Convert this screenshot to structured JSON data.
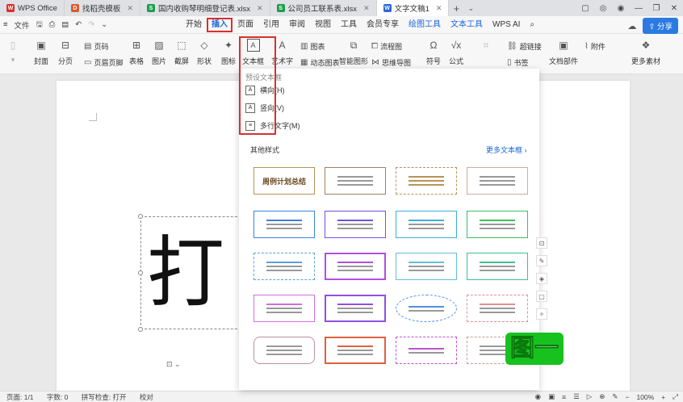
{
  "tabs": [
    {
      "label": "WPS Office",
      "icon": "wps-logo-icon",
      "color": "#d9302c"
    },
    {
      "label": "找稻壳模板",
      "icon": "docer-icon",
      "color": "#e0572a"
    },
    {
      "label": "国内收购琴明细登记表.xlsx",
      "icon": "sheet-icon",
      "color": "#1e9e4a"
    },
    {
      "label": "公司员工联系表.xlsx",
      "icon": "sheet-icon",
      "color": "#1e9e4a"
    },
    {
      "label": "文字文稿1",
      "icon": "writer-icon",
      "color": "#2a66d6"
    }
  ],
  "menu": {
    "file_label": "文件",
    "items": [
      "开始",
      "插入",
      "页面",
      "引用",
      "审阅",
      "视图",
      "工具",
      "会员专享",
      "绘图工具",
      "文本工具",
      "WPS AI"
    ],
    "active": "插入",
    "share_label": "分享"
  },
  "ribbon": {
    "cover": "封面",
    "page_break": "分页",
    "page_code": "页码",
    "header_footer": "页眉页脚",
    "table": "表格",
    "picture": "图片",
    "screenshot": "截屏",
    "shape": "形状",
    "icon": "图标",
    "textbox": "文本框",
    "art_text": "艺术字",
    "chart": "图表",
    "dynamic_chart": "动态图表",
    "smart_graphic": "智能图形",
    "flowchart": "流程图",
    "mindmap": "思维导图",
    "symbol": "符号",
    "formula": "公式",
    "hyperlink": "超链接",
    "bookmark": "书签",
    "doc_parts": "文档部件",
    "attachment": "附件",
    "more_material": "更多素材"
  },
  "dropdown": {
    "preset_section": "预设文本框",
    "horizontal": "横向(H)",
    "vertical": "竖向(V)",
    "multiline": "多行文字(M)",
    "other_section": "其他样式",
    "more_link": "更多文本框",
    "template_title": "周例计划总结"
  },
  "document": {
    "big_char": "打"
  },
  "caption": "图一",
  "status": {
    "page": "页面: 1/1",
    "words": "字数: 0",
    "spell": "拼写检查: 打开",
    "proof": "校对",
    "zoom": "100%"
  }
}
